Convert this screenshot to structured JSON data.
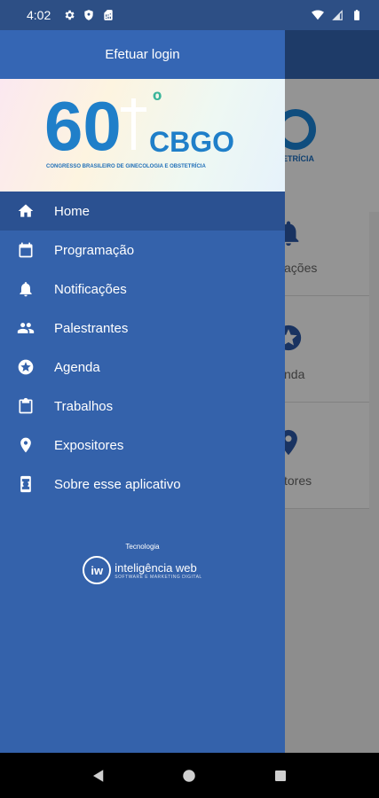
{
  "status_bar": {
    "time": "4:02",
    "left_icons": [
      "gear-icon",
      "shield-icon",
      "sim-card-icon"
    ],
    "right_icons": [
      "wifi-icon",
      "signal-icon",
      "battery-icon"
    ]
  },
  "drawer": {
    "login_label": "Efetuar login",
    "banner": {
      "number": "60",
      "degree": "º",
      "acronym": "CBGO",
      "subtitle": "CONGRESSO BRASILEIRO DE GINECOLOGIA E OBSTETRÍCIA"
    },
    "menu": [
      {
        "label": "Home",
        "icon": "home-icon",
        "active": true
      },
      {
        "label": "Programação",
        "icon": "calendar-icon",
        "active": false
      },
      {
        "label": "Notificações",
        "icon": "bell-icon",
        "active": false
      },
      {
        "label": "Palestrantes",
        "icon": "people-icon",
        "active": false
      },
      {
        "label": "Agenda",
        "icon": "star-circle-icon",
        "active": false
      },
      {
        "label": "Trabalhos",
        "icon": "clipboard-icon",
        "active": false
      },
      {
        "label": "Expositores",
        "icon": "location-pin-icon",
        "active": false
      },
      {
        "label": "Sobre esse aplicativo",
        "icon": "phone-info-icon",
        "active": false
      }
    ],
    "tech": {
      "label": "Tecnologia",
      "logo_initials": "iw",
      "logo_name": "inteligência web",
      "logo_tagline": "SOFTWARE E MARKETING DIGITAL"
    }
  },
  "background": {
    "logo_text": "ETRÍCIA",
    "cards": [
      {
        "label": "ações"
      },
      {
        "label": "nda"
      },
      {
        "label": "tores"
      }
    ]
  },
  "colors": {
    "drawer_bg": "#3462ab",
    "drawer_active": "#2b5191",
    "header_bg": "#3566b4",
    "status_bg": "#2d4f85"
  },
  "nav_bar": {
    "buttons": [
      "back-icon",
      "home-circle-icon",
      "recents-icon"
    ]
  }
}
